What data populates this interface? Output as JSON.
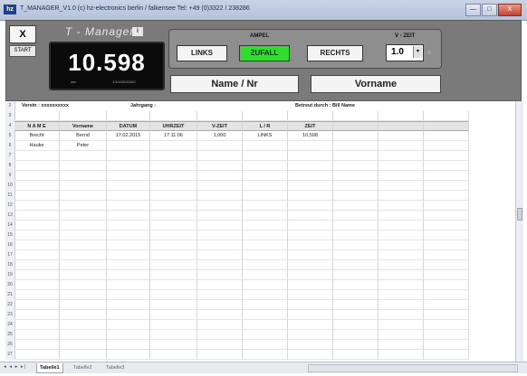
{
  "window": {
    "title": "T_MANAGER_V1.0   (c) hz-electronics berlin / falkensee   Tel: +49 (0)3322 / 238286",
    "icon_label": "hz",
    "controls": [
      "—",
      "□",
      "X"
    ]
  },
  "panel": {
    "close_label": "X",
    "start_label": "START",
    "app_title": "T - Manager",
    "badge": "i",
    "display_value": "10.598",
    "display_unit": "sec",
    "display_scale": "1/10/100/1000",
    "ampel_label": "AMPEL",
    "links_label": "LINKS",
    "zufall_label": "ZUFALL",
    "rechts_label": "RECHTS",
    "vzeit_label": "V - ZEIT",
    "vzeit_value": "1.0",
    "vzeit_unit": "s",
    "name_field": "Name / Nr",
    "vorname_field": "Vorname",
    "colors": {
      "zufall_active": "#2fdc2f",
      "panel": "#7a7a7a"
    }
  },
  "sheet": {
    "info": {
      "verein": "Verein :  xxxxxxxxxx",
      "jahrgang": "Jahrgang :",
      "betreut": "Betreut durch :  Bill  Name"
    },
    "headers": [
      "N A M E",
      "Vorname",
      "DATUM",
      "UHRZEIT",
      "V-ZEIT",
      "L / R",
      "ZEIT",
      "",
      "",
      ""
    ],
    "rows": [
      [
        "Brecht",
        "Bernd",
        "17.02.2015",
        "17:11:06",
        "1,000",
        "LINKS",
        "10,598"
      ],
      [
        "Hauke",
        "Peter",
        "",
        "",
        "",
        "",
        ""
      ]
    ],
    "row_numbers": [
      "2",
      "3",
      "4",
      "5",
      "6",
      "7",
      "8",
      "9",
      "10",
      "11",
      "12",
      "13",
      "14",
      "15",
      "16",
      "17",
      "18",
      "19",
      "20",
      "21",
      "22",
      "23",
      "24",
      "25",
      "26",
      "27"
    ]
  },
  "tabs": {
    "nav": "◂ ◂ ▸ ▸|",
    "items": [
      "Tabelle1",
      "Tabelle2",
      "Tabelle3"
    ],
    "active": "Tabelle1"
  }
}
